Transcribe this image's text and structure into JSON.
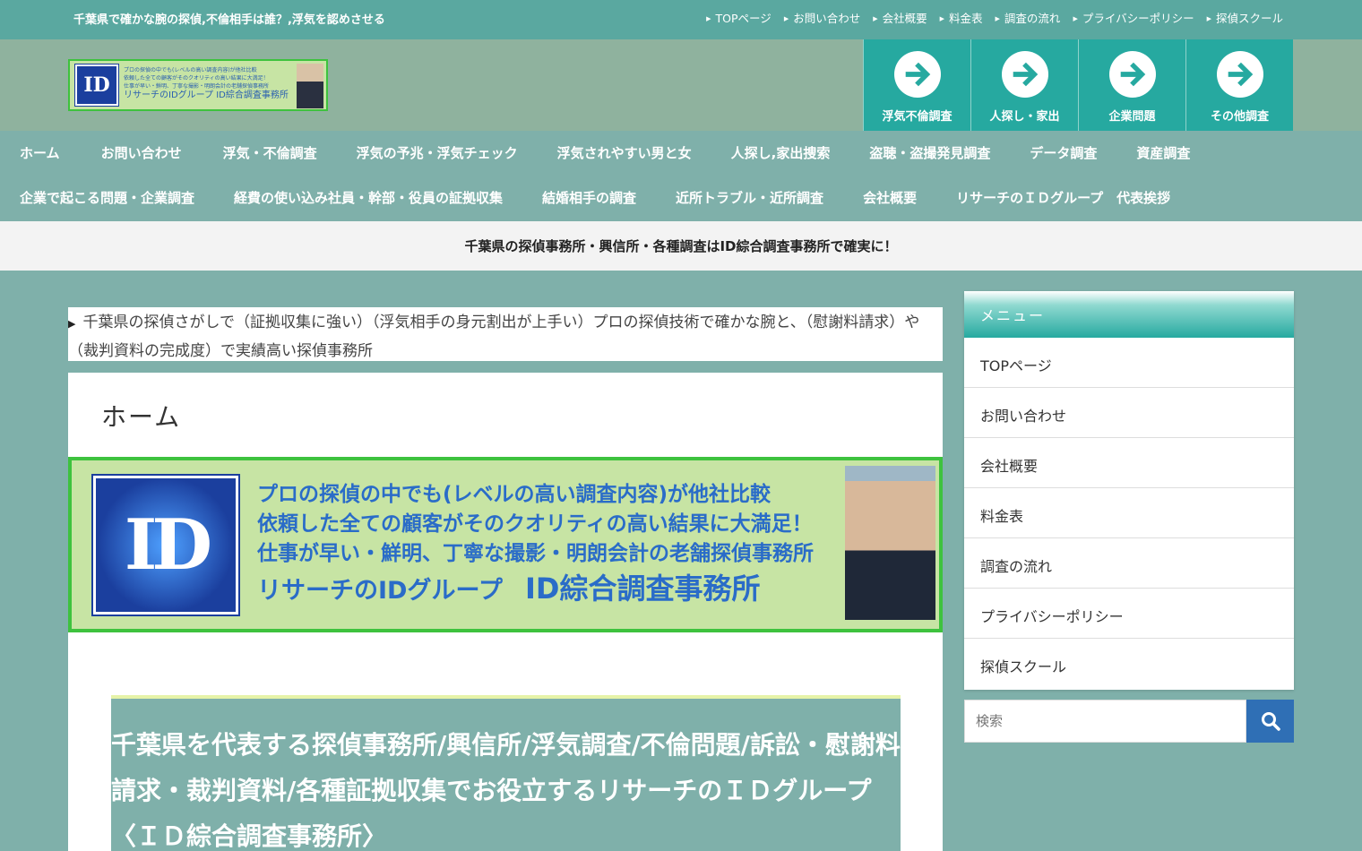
{
  "topbar": {
    "tagline": "千葉県で確かな腕の探偵,不倫相手は誰？,浮気を認めさせる",
    "links": [
      "TOPページ",
      "お問い合わせ",
      "会社概要",
      "料金表",
      "調査の流れ",
      "プライバシーポリシー",
      "探偵スクール"
    ]
  },
  "header": {
    "logo": {
      "id_text": "ID",
      "lines": [
        "プロの探偵の中でも(レベルの高い調査内容)が他社比較",
        "依頼した全ての顧客がそのクオリティの高い結果に大満足！",
        "仕事が早い・鮮明、丁寧な撮影・明朗会計の老舗探偵事務所"
      ],
      "name": "リサーチのIDグループ ID綜合調査事務所"
    },
    "buttons": [
      "浮気不倫調査",
      "人探し・家出",
      "企業問題",
      "その他調査"
    ]
  },
  "mainnav": {
    "row1": [
      "ホーム",
      "お問い合わせ",
      "浮気・不倫調査",
      "浮気の予兆・浮気チェック",
      "浮気されやすい男と女",
      "人探し,家出捜索",
      "盗聴・盗撮発見調査",
      "データ調査",
      "資産調査"
    ],
    "row2": [
      "企業で起こる問題・企業調査",
      "経費の使い込み社員・幹部・役員の証拠収集",
      "結婚相手の調査",
      "近所トラブル・近所調査",
      "会社概要",
      "リサーチのＩＤグループ　代表挨拶"
    ]
  },
  "notice": "千葉県の探偵事務所・興信所・各種調査はID綜合調査事務所で確実に！",
  "breadcrumb": "千葉県の探偵さがしで（証拠収集に強い）（浮気相手の身元割出が上手い）プロの探偵技術で確かな腕と、（慰謝料請求）や（裁判資料の完成度）で実績高い探偵事務所",
  "page_title": "ホーム",
  "banner": {
    "id_text": "ID",
    "line1": "プロの探偵の中でも(レベルの高い調査内容)が他社比較",
    "line2": "依頼した全ての顧客がそのクオリティの高い結果に大満足！",
    "line3": "仕事が早い・鮮明、丁寧な撮影・明朗会計の老舗探偵事務所",
    "line4a": "リサーチのIDグループ",
    "line4b": "ID綜合調査事務所"
  },
  "heading": "千葉県を代表する探偵事務所/興信所/浮気調査/不倫問題/訴訟・慰謝料請求・裁判資料/各種証拠収集でお役立するリサーチのＩＤグループ〈ＩＤ綜合調査事務所〉",
  "sidebar": {
    "title": "メニュー",
    "items": [
      "TOPページ",
      "お問い合わせ",
      "会社概要",
      "料金表",
      "調査の流れ",
      "プライバシーポリシー",
      "探偵スクール"
    ]
  },
  "search": {
    "placeholder": "検索"
  }
}
